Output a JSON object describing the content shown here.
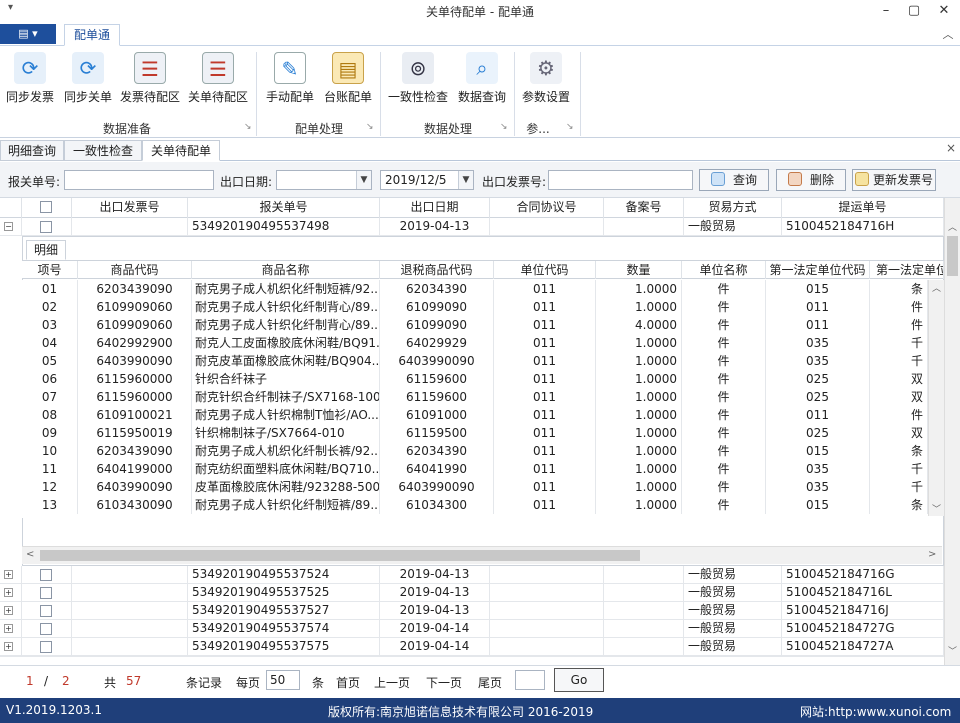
{
  "window": {
    "title": "关单待配单 - 配单通",
    "qat": "▾",
    "minimize": "–",
    "maximize": "▢",
    "close": "✕"
  },
  "ribbon": {
    "app_button": "▤ ▾",
    "tab": "配单通",
    "collapse": "︿",
    "groups": [
      {
        "label": "数据准备",
        "buttons": [
          {
            "label": "同步发票",
            "icon": "sync-invoice-icon"
          },
          {
            "label": "同步关单",
            "icon": "sync-customs-icon"
          },
          {
            "label": "发票待配区",
            "icon": "invoice-pending-icon"
          },
          {
            "label": "关单待配区",
            "icon": "customs-pending-icon"
          }
        ]
      },
      {
        "label": "配单处理",
        "buttons": [
          {
            "label": "手动配单",
            "icon": "manual-match-icon"
          },
          {
            "label": "台账配单",
            "icon": "ledger-match-icon"
          }
        ]
      },
      {
        "label": "数据处理",
        "buttons": [
          {
            "label": "一致性检查",
            "icon": "binoculars-icon"
          },
          {
            "label": "数据查询",
            "icon": "magnifier-icon"
          }
        ]
      },
      {
        "label": "参...",
        "buttons": [
          {
            "label": "参数设置",
            "icon": "gear-icon"
          }
        ]
      }
    ],
    "launcher": "↘"
  },
  "doc_tabs": [
    "明细查询",
    "一致性检查",
    "关单待配单"
  ],
  "doc_close": "×",
  "search": {
    "customs_no_label": "报关单号:",
    "customs_no_value": "",
    "export_date_label": "出口日期:",
    "date_from": "",
    "date_to": "2019/12/5",
    "invoice_no_label": "出口发票号:",
    "invoice_no_value": "",
    "query": "查询",
    "delete": "删除",
    "update_invoice": "更新发票号"
  },
  "grid": {
    "headers": [
      "出口发票号",
      "报关单号",
      "出口日期",
      "合同协议号",
      "备案号",
      "贸易方式",
      "提运单号"
    ],
    "expanded_row": {
      "invoice": "",
      "customs": "534920190495537498",
      "date": "2019-04-13",
      "contract": "",
      "record": "",
      "trade": "一般贸易",
      "bl": "5100452184716H"
    },
    "rows": [
      {
        "customs": "534920190495537524",
        "date": "2019-04-13",
        "trade": "一般贸易",
        "bl": "5100452184716G"
      },
      {
        "customs": "534920190495537525",
        "date": "2019-04-13",
        "trade": "一般贸易",
        "bl": "5100452184716L"
      },
      {
        "customs": "534920190495537527",
        "date": "2019-04-13",
        "trade": "一般贸易",
        "bl": "5100452184716J"
      },
      {
        "customs": "534920190495537574",
        "date": "2019-04-14",
        "trade": "一般贸易",
        "bl": "5100452184727G"
      },
      {
        "customs": "534920190495537575",
        "date": "2019-04-14",
        "trade": "一般贸易",
        "bl": "5100452184727A"
      }
    ]
  },
  "detail": {
    "tab": "明细",
    "headers": [
      "项号",
      "商品代码",
      "商品名称",
      "退税商品代码",
      "单位代码",
      "数量",
      "单位名称",
      "第一法定单位代码",
      "第一法定单位"
    ],
    "rows": [
      {
        "no": "01",
        "code": "6203439090",
        "name": "耐克男子成人机织化纤制短裤/92...",
        "tax": "62034390",
        "unit": "011",
        "qty": "1.0000",
        "uname": "件",
        "lcode": "015",
        "lname": "条"
      },
      {
        "no": "02",
        "code": "6109909060",
        "name": "耐克男子成人针织化纤制背心/89...",
        "tax": "61099090",
        "unit": "011",
        "qty": "1.0000",
        "uname": "件",
        "lcode": "011",
        "lname": "件"
      },
      {
        "no": "03",
        "code": "6109909060",
        "name": "耐克男子成人针织化纤制背心/89...",
        "tax": "61099090",
        "unit": "011",
        "qty": "4.0000",
        "uname": "件",
        "lcode": "011",
        "lname": "件"
      },
      {
        "no": "04",
        "code": "6402992900",
        "name": "耐克人工皮面橡胶底休闲鞋/BQ91...",
        "tax": "64029929",
        "unit": "011",
        "qty": "1.0000",
        "uname": "件",
        "lcode": "035",
        "lname": "千"
      },
      {
        "no": "05",
        "code": "6403990090",
        "name": "耐克皮革面橡胶底休闲鞋/BQ904...",
        "tax": "6403990090",
        "unit": "011",
        "qty": "1.0000",
        "uname": "件",
        "lcode": "035",
        "lname": "千"
      },
      {
        "no": "06",
        "code": "6115960000",
        "name": "针织合纤袜子",
        "tax": "61159600",
        "unit": "011",
        "qty": "1.0000",
        "uname": "件",
        "lcode": "025",
        "lname": "双"
      },
      {
        "no": "07",
        "code": "6115960000",
        "name": "耐克针织合纤制袜子/SX7168-100",
        "tax": "61159600",
        "unit": "011",
        "qty": "1.0000",
        "uname": "件",
        "lcode": "025",
        "lname": "双"
      },
      {
        "no": "08",
        "code": "6109100021",
        "name": "耐克男子成人针织棉制T恤衫/AO...",
        "tax": "61091000",
        "unit": "011",
        "qty": "1.0000",
        "uname": "件",
        "lcode": "011",
        "lname": "件"
      },
      {
        "no": "09",
        "code": "6115950019",
        "name": "针织棉制袜子/SX7664-010",
        "tax": "61159500",
        "unit": "011",
        "qty": "1.0000",
        "uname": "件",
        "lcode": "025",
        "lname": "双"
      },
      {
        "no": "10",
        "code": "6203439090",
        "name": "耐克男子成人机织化纤制长裤/92...",
        "tax": "62034390",
        "unit": "011",
        "qty": "1.0000",
        "uname": "件",
        "lcode": "015",
        "lname": "条"
      },
      {
        "no": "11",
        "code": "6404199000",
        "name": "耐克纺织面塑料底休闲鞋/BQ710...",
        "tax": "64041990",
        "unit": "011",
        "qty": "1.0000",
        "uname": "件",
        "lcode": "035",
        "lname": "千"
      },
      {
        "no": "12",
        "code": "6403990090",
        "name": "皮革面橡胶底休闲鞋/923288-500",
        "tax": "6403990090",
        "unit": "011",
        "qty": "1.0000",
        "uname": "件",
        "lcode": "035",
        "lname": "千"
      },
      {
        "no": "13",
        "code": "6103430090",
        "name": "耐克男子成人针织化纤制短裤/89...",
        "tax": "61034300",
        "unit": "011",
        "qty": "1.0000",
        "uname": "件",
        "lcode": "015",
        "lname": "条"
      }
    ]
  },
  "pager": {
    "current": "1",
    "slash": "/",
    "total_pages": "2",
    "total_label": "共",
    "total_records": "57",
    "records_label": "条记录",
    "per_page_label": "每页",
    "per_page": "50",
    "unit": "条",
    "first": "首页",
    "prev": "上一页",
    "next": "下一页",
    "last": "尾页",
    "goto_value": "",
    "go": "Go"
  },
  "status": {
    "version": "V1.2019.1203.1",
    "copyright": "版权所有:南京旭诺信息技术有限公司 2016-2019",
    "website": "网站:http:www.xunoi.com"
  },
  "colors": {
    "accent": "#1e4f9c",
    "status_bg": "#1f3f7a",
    "page_red": "#c0392b"
  }
}
